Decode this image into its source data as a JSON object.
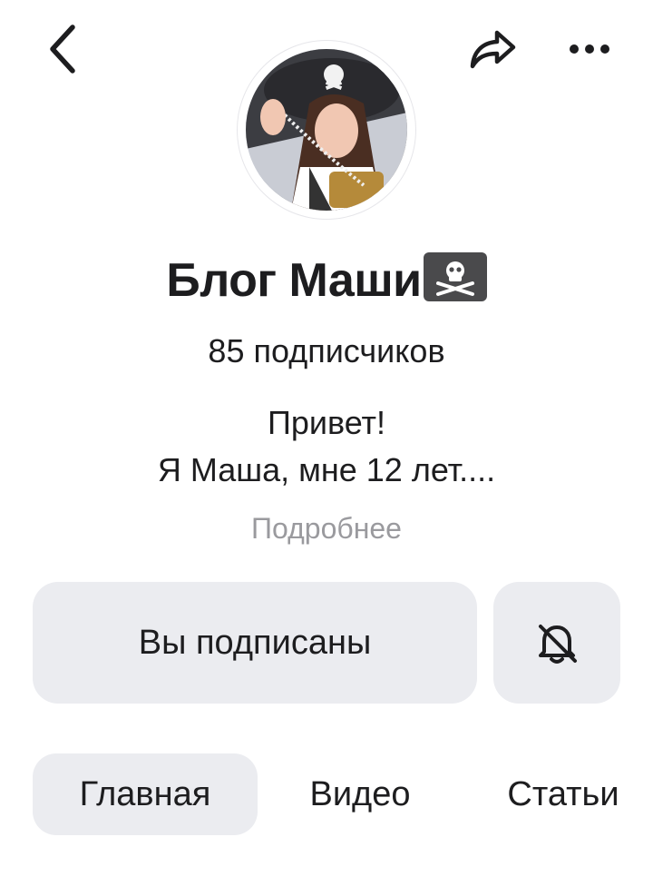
{
  "header": {
    "back_icon": "chevron-left-icon",
    "share_icon": "share-arrow-icon",
    "more_icon": "more-dots-icon"
  },
  "profile": {
    "avatar": "avatar-photo",
    "title": "Блог Маши",
    "title_emoji": "pirate-flag-icon",
    "subscribers": "85 подписчиков",
    "about_line1": "Привет!",
    "about_line2": "Я Маша, мне 12 лет....",
    "more_link": "Подробнее"
  },
  "actions": {
    "subscribed_label": "Вы подписаны",
    "bell_icon": "bell-off-icon"
  },
  "tabs": [
    {
      "label": "Главная",
      "active": true
    },
    {
      "label": "Видео",
      "active": false
    },
    {
      "label": "Статьи",
      "active": false
    }
  ],
  "colors": {
    "background": "#ffffff",
    "text": "#1d1d1f",
    "muted": "#9a9a9e",
    "button_bg": "#ebecf0"
  }
}
